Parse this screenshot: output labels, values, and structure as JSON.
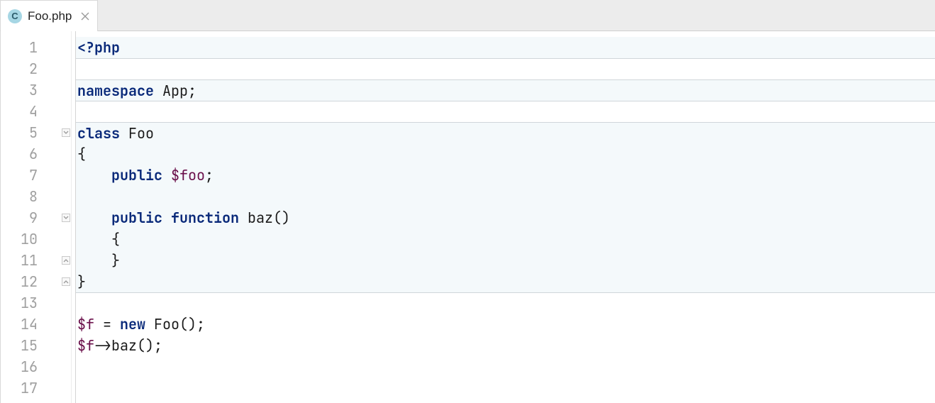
{
  "tab": {
    "icon_letter": "C",
    "filename": "Foo.php"
  },
  "gutter": {
    "lines": [
      "1",
      "2",
      "3",
      "4",
      "5",
      "6",
      "7",
      "8",
      "9",
      "10",
      "11",
      "12",
      "13",
      "14",
      "15",
      "16",
      "17"
    ]
  },
  "fold_markers": [
    {
      "line": 5,
      "dir": "down"
    },
    {
      "line": 9,
      "dir": "down"
    },
    {
      "line": 11,
      "dir": "up"
    },
    {
      "line": 12,
      "dir": "up"
    }
  ],
  "highlights": {
    "ranges": [
      {
        "from": 1,
        "to": 1
      },
      {
        "from": 3,
        "to": 3
      },
      {
        "from": 5,
        "to": 12
      }
    ]
  },
  "code": {
    "l1_open": "<?php",
    "l3_ns": "namespace",
    "l3_name": " App",
    "l3_end": ";",
    "l5_class": "class",
    "l5_name": " Foo",
    "l6": "{",
    "l7_pub": "public",
    "l7_var": " $foo",
    "l7_end": ";",
    "l9_pub": "public",
    "l9_fn": " function",
    "l9_name": " baz",
    "l9_par": "()",
    "l10": "{",
    "l11": "}",
    "l12": "}",
    "l14_var": "$f",
    "l14_eq": " = ",
    "l14_new": "new",
    "l14_cls": " Foo",
    "l14_par": "();",
    "l15_var": "$f",
    "l15_arrow": "->",
    "l15_call": "baz",
    "l15_par": "();"
  }
}
